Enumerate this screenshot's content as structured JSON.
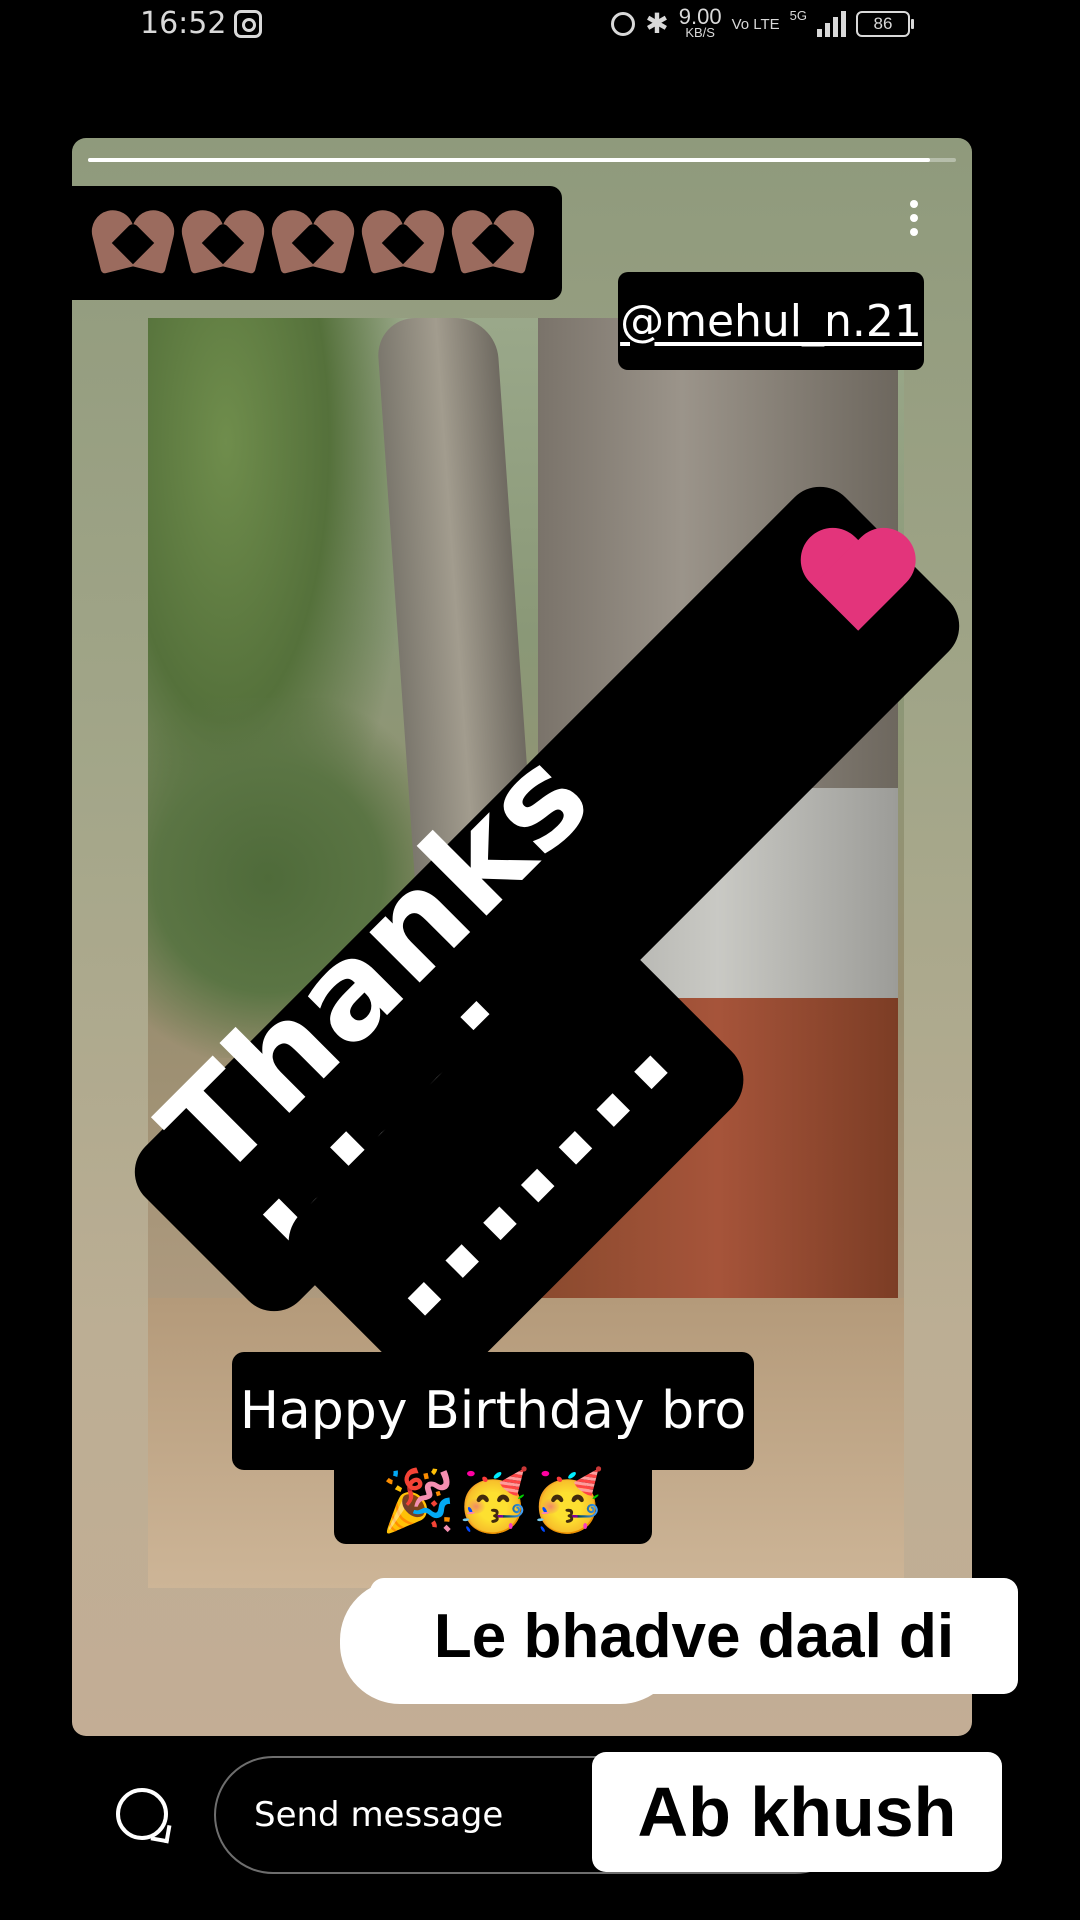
{
  "status_bar": {
    "time": "16:52",
    "speed_value": "9.00",
    "speed_unit": "KB/S",
    "volte": "Vo LTE",
    "network": "5G",
    "battery": "86"
  },
  "story": {
    "progress": 0.97,
    "hearts_count": 5,
    "mention": "@mehul_n.21",
    "thanks_text": "Thanks bhai",
    "dots_text": ".......",
    "birthday_text": "Happy Birthday bro",
    "birthday_emojis": "🎉🥳🥳"
  },
  "overlay": {
    "le_text": "Le bhadve daal di",
    "ab_khush": "Ab khush"
  },
  "bottom_bar": {
    "send_placeholder": "Send message"
  }
}
